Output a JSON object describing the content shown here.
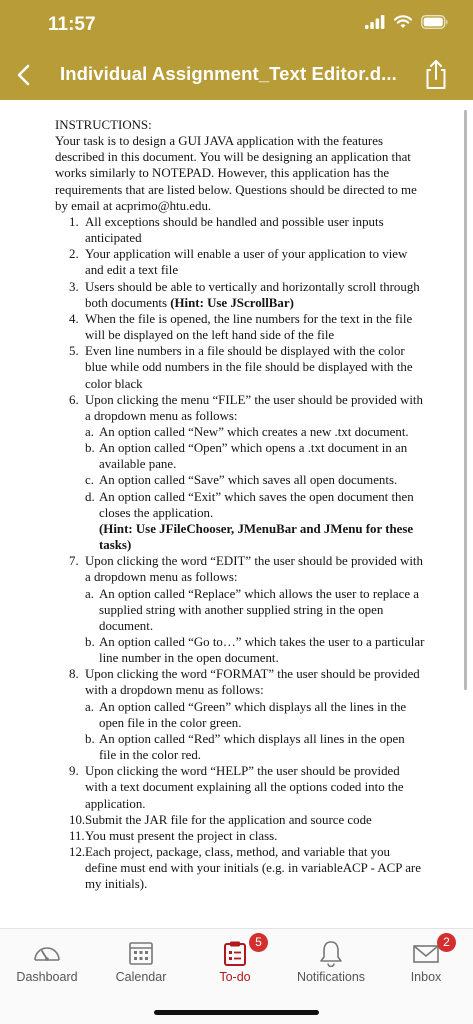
{
  "status_bar": {
    "time": "11:57"
  },
  "header": {
    "title": "Individual Assignment_Text Editor.d..."
  },
  "document": {
    "heading": "INSTRUCTIONS:",
    "intro": "Your task is to design a GUI JAVA application with the features described in this document. You will be designing an application that works similarly to NOTEPAD. However, this application has the requirements that are listed below. Questions should be directed to me by email at acprimo@htu.edu.",
    "items": [
      {
        "n": "1.",
        "text": "All exceptions should be handled and possible user inputs anticipated"
      },
      {
        "n": "2.",
        "text": "Your application will enable a user of your application to view and edit a text file"
      },
      {
        "n": "3.",
        "text": "Users should be able to vertically and horizontally scroll through both documents ",
        "bold": "(Hint: Use JScrollBar)"
      },
      {
        "n": "4.",
        "text": "When the file is opened, the line numbers for the text in the file will be displayed on the left hand side of the file"
      },
      {
        "n": "5.",
        "text": "Even line numbers in a file should be displayed with the color blue  while odd numbers in the file should be displayed with the color black"
      },
      {
        "n": "6.",
        "text": "Upon clicking the menu “FILE” the user should be provided with a dropdown menu as follows:",
        "sub": [
          {
            "n": "a.",
            "text": "An option called “New” which creates a new .txt document."
          },
          {
            "n": "b.",
            "text": "An option called “Open” which opens a .txt document in an available pane."
          },
          {
            "n": "c.",
            "text": "An option called “Save” which saves all open documents."
          },
          {
            "n": "d.",
            "text": "An option called “Exit” which saves the open document then closes the application. ",
            "bold": "(Hint: Use JFileChooser, JMenuBar and JMenu for these tasks)"
          }
        ]
      },
      {
        "n": "7.",
        "text": "Upon clicking the word “EDIT” the user should be provided with a dropdown menu as follows:",
        "sub": [
          {
            "n": "a.",
            "text": "An option called “Replace” which allows the user to replace a supplied string with another supplied string in the open document."
          },
          {
            "n": "b.",
            "text": "An option called “Go to…” which takes the user to a particular line number in the open document."
          }
        ]
      },
      {
        "n": "8.",
        "text": "Upon clicking the word “FORMAT” the user should be provided with a dropdown menu as follows:",
        "sub": [
          {
            "n": "a.",
            "text": "An option called “Green” which displays all the lines in the open file in the color green."
          },
          {
            "n": "b.",
            "text": "An option called “Red” which displays all lines in the open file in the color red."
          }
        ]
      },
      {
        "n": "9.",
        "text": "Upon clicking the word “HELP” the user should be provided with a text document explaining all the options coded into the application."
      },
      {
        "n": "10.",
        "text": "Submit the JAR file for the application and source code"
      },
      {
        "n": "11.",
        "text": "You must present the project in class."
      },
      {
        "n": "12.",
        "text": "Each project, package, class, method, and variable that you define must end with your initials (e.g.  in variableACP - ACP are my initials)."
      }
    ]
  },
  "tabs": [
    {
      "label": "Dashboard",
      "icon": "dashboard-gauge-icon"
    },
    {
      "label": "Calendar",
      "icon": "calendar-icon"
    },
    {
      "label": "To-do",
      "icon": "todo-clipboard-icon",
      "badge": "5",
      "active": true
    },
    {
      "label": "Notifications",
      "icon": "bell-icon"
    },
    {
      "label": "Inbox",
      "icon": "envelope-icon",
      "badge": "2"
    }
  ],
  "colors": {
    "header_bg": "#b79c38",
    "active_tab": "#b0191e",
    "badge": "#d32f2f"
  }
}
